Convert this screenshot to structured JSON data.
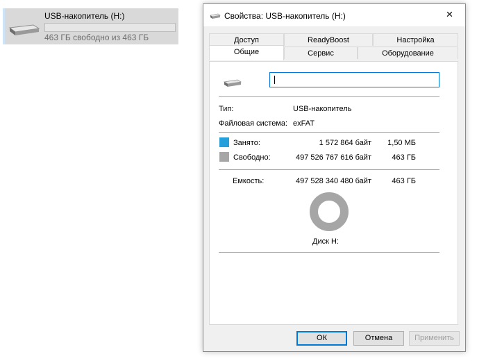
{
  "explorer": {
    "drive_name": "USB-накопитель (H:)",
    "drive_info": "463 ГБ свободно из 463 ГБ",
    "used_fraction": 0.0
  },
  "dialog": {
    "title": "Свойства: USB-накопитель (H:)",
    "close_icon": "×",
    "tabs": {
      "row_top": [
        "Доступ",
        "ReadyBoost",
        "Настройка"
      ],
      "row_bottom": [
        "Общие",
        "Сервис",
        "Оборудование"
      ],
      "active": "Общие"
    },
    "general": {
      "volume_label_value": "",
      "type_label": "Тип:",
      "type_value": "USB-накопитель",
      "fs_label": "Файловая система:",
      "fs_value": "exFAT",
      "used_label": "Занято:",
      "used_bytes": "1 572 864 байт",
      "used_size": "1,50 МБ",
      "free_label": "Свободно:",
      "free_bytes": "497 526 767 616 байт",
      "free_size": "463 ГБ",
      "capacity_label": "Емкость:",
      "capacity_bytes": "497 528 340 480 байт",
      "capacity_size": "463 ГБ",
      "disk_label": "Диск H:",
      "used_color": "#26a0da",
      "free_color": "#a6a6a6"
    },
    "buttons": {
      "ok": "ОК",
      "cancel": "Отмена",
      "apply": "Применить"
    }
  }
}
